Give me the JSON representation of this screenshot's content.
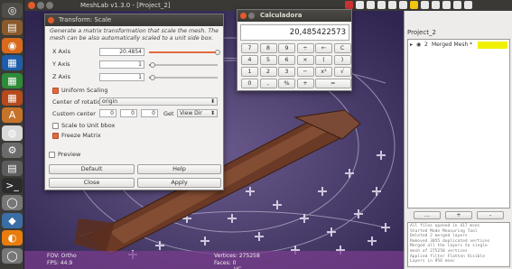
{
  "app_title": "MeshLab v1.3.0 - [Project_2]",
  "launcher": {
    "items": [
      {
        "name": "dash-home-icon",
        "glyph": "◎",
        "bg": "#4e4d48"
      },
      {
        "name": "files-icon",
        "glyph": "▤",
        "bg": "#8a5a2b"
      },
      {
        "name": "firefox-icon",
        "glyph": "◉",
        "bg": "#d86a1c"
      },
      {
        "name": "libreoffice-writer-icon",
        "glyph": "▦",
        "bg": "#1f5da8"
      },
      {
        "name": "libreoffice-calc-icon",
        "glyph": "▦",
        "bg": "#2e8b37"
      },
      {
        "name": "libreoffice-impress-icon",
        "glyph": "▦",
        "bg": "#b54a1c"
      },
      {
        "name": "software-center-icon",
        "glyph": "A",
        "bg": "#c5732a"
      },
      {
        "name": "chrome-icon",
        "glyph": "◍",
        "bg": "#d9d9d9"
      },
      {
        "name": "settings-icon",
        "glyph": "⚙",
        "bg": "#6b6b6b"
      },
      {
        "name": "calculator-icon",
        "glyph": "▤",
        "bg": "#5d5d5d"
      },
      {
        "name": "terminal-icon",
        "glyph": ">_",
        "bg": "#2c2c2c"
      },
      {
        "name": "disk-icon",
        "glyph": "◯",
        "bg": "#777"
      },
      {
        "name": "meshlab-icon",
        "glyph": "◆",
        "bg": "#3a6ea5"
      },
      {
        "name": "blender-icon",
        "glyph": "◐",
        "bg": "#e87d0d"
      },
      {
        "name": "disk-2-icon",
        "glyph": "◯",
        "bg": "#777"
      }
    ]
  },
  "transform_dialog": {
    "title": "Transform: Scale",
    "description": "Generate a matrix transformation that scale the mesh. The mesh can be also automatically scaled to a unit side box.",
    "x_label": "X Axis",
    "x_value": "20.4854",
    "x_level": 1.0,
    "y_label": "Y Axis",
    "y_value": "1",
    "y_level": 0.05,
    "z_label": "Z Axis",
    "z_value": "1",
    "z_level": 0.05,
    "uniform_label": "Uniform Scaling",
    "uniform_checked": true,
    "center_label": "Center of rotation:",
    "center_value": "origin",
    "custom_center_label": "Custom center",
    "cx": "0",
    "cy": "0",
    "cz": "0",
    "get_label": "Get",
    "view_dir": "View Dir",
    "scale_unit_label": "Scale to Unit bbox",
    "scale_unit_checked": false,
    "freeze_label": "Freeze Matrix",
    "freeze_checked": true,
    "preview_label": "Preview",
    "preview_checked": false,
    "default_btn": "Default",
    "help_btn": "Help",
    "close_btn": "Close",
    "apply_btn": "Apply"
  },
  "calculator": {
    "title": "Calculadora",
    "display": "20,485422573",
    "rows": [
      [
        "7",
        "8",
        "9",
        "÷",
        "←",
        "C"
      ],
      [
        "4",
        "5",
        "6",
        "×",
        "(",
        ")"
      ],
      [
        "1",
        "2",
        "3",
        "−",
        "x²",
        "√"
      ],
      [
        "0",
        ",",
        "%",
        "+",
        "="
      ]
    ]
  },
  "project_panel": {
    "title": "Project_2",
    "layer_num": "2",
    "layer_name": "Merged Mesh *",
    "buttons": [
      "...",
      "+",
      "-"
    ],
    "log": [
      "All files opened in 417 msec",
      "Started Mode Measuring Tool",
      "Deleted 2 merged layers",
      "Removed 3055 duplicated vertices",
      "Merged all the layers to single",
      "mesh of 275258 vertices",
      "Applied filter Flatten Visible",
      "Layers in 956 msec"
    ]
  },
  "viewport_status": {
    "fov": "FOV: Ortho",
    "fps": "FPS:  44.9",
    "vertices": "Vertices: 275258",
    "faces": "Faces: 0",
    "vc": "VC"
  },
  "colors": {
    "accent": "#e3683e",
    "highlight_layer": "#f0f000"
  }
}
